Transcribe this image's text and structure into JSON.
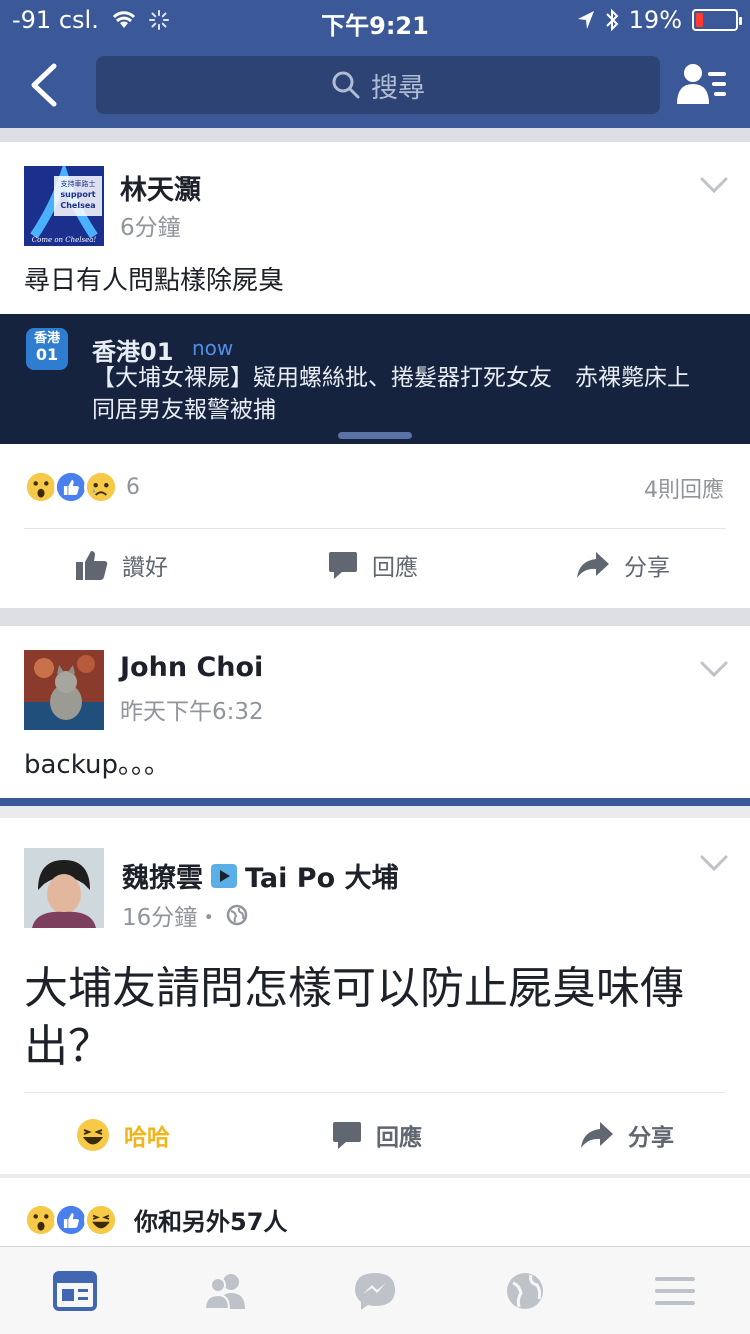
{
  "status": {
    "carrier": "-91 csl.",
    "time": "下午9:21",
    "battery": "19%"
  },
  "search": {
    "placeholder": "搜尋"
  },
  "post1": {
    "author": "林天灝",
    "time": "6分鐘",
    "text": "尋日有人問點樣除屍臭",
    "avatar_lines": [
      "支持車路士",
      "support",
      "Chelsea",
      "Come on Chelsea!"
    ],
    "notification": {
      "app_icon_top": "香港",
      "app_icon_bottom": "01",
      "app": "香港01",
      "when": "now",
      "message": "【大埔女裸屍】疑用螺絲批、捲髮器打死女友　赤裸斃床上　同居男友報警被捕"
    },
    "reaction_count": "6",
    "comments": "4則回應",
    "actions": {
      "like": "讚好",
      "comment": "回應",
      "share": "分享"
    }
  },
  "post2": {
    "author": "John Choi",
    "time": "昨天下午6:32",
    "text": "backup。。。"
  },
  "shared": {
    "author": "魏撩雲",
    "group": "Tai Po 大埔",
    "time": "16分鐘・",
    "text": "大埔友請問怎樣可以防止屍臭味傳出？",
    "actions": {
      "haha": "哈哈",
      "comment": "回應",
      "share": "分享"
    },
    "reactions_summary": "你和另外57人"
  },
  "tabs": [
    "news-feed-icon",
    "friends-icon",
    "messenger-icon",
    "notifications-globe-icon",
    "menu-icon"
  ],
  "colors": {
    "brand": "#3b5998",
    "active_tab": "#4267b2",
    "haha": "#f2b41c"
  }
}
